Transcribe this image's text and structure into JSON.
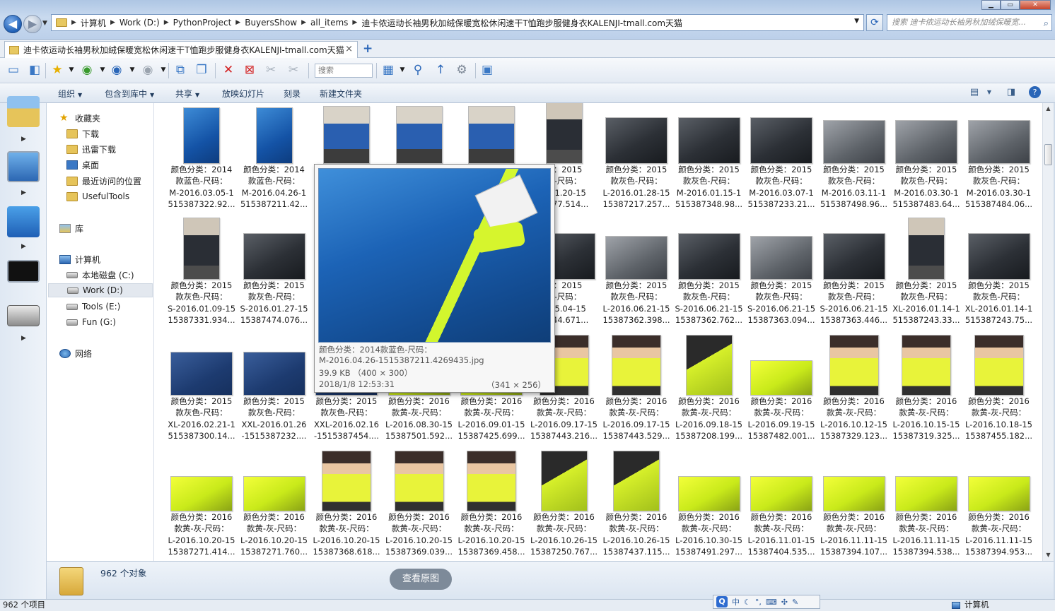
{
  "address": {
    "back_icon": "back-arrow-icon",
    "forward_icon": "forward-arrow-icon",
    "crumbs": [
      "计算机",
      "Work (D:)",
      "PythonProject",
      "BuyersShow",
      "all_items",
      "迪卡侬运动长袖男秋加绒保暖宽松休闲速干T恤跑步服健身衣KALENJI-tmall.com天猫"
    ],
    "search_placeholder": "搜索 迪卡侬运动长袖男秋加绒保暖宽..."
  },
  "tab": {
    "title": "迪卡侬运动长袖男秋加绒保暖宽松休闲速干T恤跑步服健身衣KALENJI-tmall.com天猫",
    "close": "×",
    "new": "+"
  },
  "toolbar": {
    "search_label": "搜索"
  },
  "commands": [
    {
      "label": "组织",
      "dropdown": true
    },
    {
      "label": "包含到库中",
      "dropdown": true
    },
    {
      "label": "共享",
      "dropdown": true
    },
    {
      "label": "放映幻灯片",
      "dropdown": false
    },
    {
      "label": "刻录",
      "dropdown": false
    },
    {
      "label": "新建文件夹",
      "dropdown": false
    }
  ],
  "nav": {
    "favorites": "收藏夹",
    "downloads": "下载",
    "xunlei": "迅雷下载",
    "desktop": "桌面",
    "recent": "最近访问的位置",
    "usefultools": "UsefulTools",
    "libraries": "库",
    "computer": "计算机",
    "drive_c": "本地磁盘 (C:)",
    "drive_d": "Work (D:)",
    "drive_e": "Tools (E:)",
    "drive_g": "Fun (G:)",
    "network": "网络"
  },
  "items": [
    {
      "l1": "颜色分类：2014",
      "l2": "款蓝色-尺码：",
      "l3": "M-2016.03.05-1",
      "l4": "515387322.92...",
      "thumb": "blue"
    },
    {
      "l1": "颜色分类：2014",
      "l2": "款蓝色-尺码：",
      "l3": "M-2016.04.26-1",
      "l4": "515387211.42...",
      "thumb": "blue"
    },
    {
      "l1": "",
      "l2": "",
      "l3": "",
      "l4": "",
      "thumb": "person"
    },
    {
      "l1": "",
      "l2": "",
      "l3": "",
      "l4": "",
      "thumb": "person"
    },
    {
      "l1": "",
      "l2": "",
      "l3": "",
      "l4": "",
      "thumb": "person"
    },
    {
      "l1": "...：2015",
      "l2": "...-尺码：",
      "l3": "...01.20-15",
      "l4": "...477.514...",
      "thumb": "persondk"
    },
    {
      "l1": "颜色分类：2015",
      "l2": "款灰色-尺码：",
      "l3": "L-2016.01.28-15",
      "l4": "15387217.257...",
      "thumb": "dark"
    },
    {
      "l1": "颜色分类：2015",
      "l2": "款灰色-尺码：",
      "l3": "M-2016.01.15-1",
      "l4": "515387348.98...",
      "thumb": "dark"
    },
    {
      "l1": "颜色分类：2015",
      "l2": "款灰色-尺码：",
      "l3": "M-2016.03.07-1",
      "l4": "515387233.21...",
      "thumb": "dark"
    },
    {
      "l1": "颜色分类：2015",
      "l2": "款灰色-尺码：",
      "l3": "M-2016.03.11-1",
      "l4": "515387498.96...",
      "thumb": "grey"
    },
    {
      "l1": "颜色分类：2015",
      "l2": "款灰色-尺码：",
      "l3": "M-2016.03.30-1",
      "l4": "515387483.64...",
      "thumb": "grey"
    },
    {
      "l1": "颜色分类：2015",
      "l2": "款灰色-尺码：",
      "l3": "M-2016.03.30-1",
      "l4": "515387484.06...",
      "thumb": "grey"
    },
    {
      "l1": "颜色分类：2015",
      "l2": "款灰色-尺码：",
      "l3": "S-2016.01.09-15",
      "l4": "15387331.934...",
      "thumb": "persondk"
    },
    {
      "l1": "颜色分类：2015",
      "l2": "款灰色-尺码：",
      "l3": "S-2016.01.27-15",
      "l4": "15387474.076...",
      "thumb": "dark"
    },
    {
      "l1": "",
      "l2": "",
      "l3": "",
      "l4": "",
      "thumb": "dark"
    },
    {
      "l1": "",
      "l2": "",
      "l3": "",
      "l4": "",
      "thumb": "dark"
    },
    {
      "l1": "",
      "l2": "",
      "l3": "",
      "l4": "",
      "thumb": "dark"
    },
    {
      "l1": "...：2015",
      "l2": "...-尺码：",
      "l3": "...05.04-15",
      "l4": "...344.671...",
      "thumb": "dark"
    },
    {
      "l1": "颜色分类：2015",
      "l2": "款灰色-尺码：",
      "l3": "L-2016.06.21-15",
      "l4": "15387362.398...",
      "thumb": "grey"
    },
    {
      "l1": "颜色分类：2015",
      "l2": "款灰色-尺码：",
      "l3": "S-2016.06.21-15",
      "l4": "15387362.762...",
      "thumb": "dark"
    },
    {
      "l1": "颜色分类：2015",
      "l2": "款灰色-尺码：",
      "l3": "S-2016.06.21-15",
      "l4": "15387363.094...",
      "thumb": "grey"
    },
    {
      "l1": "颜色分类：2015",
      "l2": "款灰色-尺码：",
      "l3": "S-2016.06.21-15",
      "l4": "15387363.446...",
      "thumb": "dark"
    },
    {
      "l1": "颜色分类：2015",
      "l2": "款灰色-尺码：",
      "l3": "XL-2016.01.14-1",
      "l4": "515387243.33...",
      "thumb": "persondk"
    },
    {
      "l1": "颜色分类：2015",
      "l2": "款灰色-尺码：",
      "l3": "XL-2016.01.14-1",
      "l4": "515387243.75...",
      "thumb": "dark"
    },
    {
      "l1": "颜色分类：2015",
      "l2": "款灰色-尺码：",
      "l3": "XL-2016.02.21-1",
      "l4": "515387300.14...",
      "thumb": "navy"
    },
    {
      "l1": "颜色分类：2015",
      "l2": "款灰色-尺码：",
      "l3": "XXL-2016.01.26",
      "l4": "-1515387232....",
      "thumb": "navy"
    },
    {
      "l1": "颜色分类：2015",
      "l2": "款灰色-尺码：",
      "l3": "XXL-2016.02.16",
      "l4": "-1515387454....",
      "thumb": "navy"
    },
    {
      "l1": "颜色分类：2016",
      "l2": "款黄-灰-尺码：",
      "l3": "L-2016.08.30-15",
      "l4": "15387501.592...",
      "thumb": "yellow"
    },
    {
      "l1": "颜色分类：2016",
      "l2": "款黄-灰-尺码：",
      "l3": "L-2016.09.01-15",
      "l4": "15387425.699...",
      "thumb": "yellow"
    },
    {
      "l1": "颜色分类：2016",
      "l2": "款黄-灰-尺码：",
      "l3": "L-2016.09.17-15",
      "l4": "15387443.216...",
      "thumb": "ypers"
    },
    {
      "l1": "颜色分类：2016",
      "l2": "款黄-灰-尺码：",
      "l3": "L-2016.09.17-15",
      "l4": "15387443.529...",
      "thumb": "ypers"
    },
    {
      "l1": "颜色分类：2016",
      "l2": "款黄-灰-尺码：",
      "l3": "L-2016.09.18-15",
      "l4": "15387208.199...",
      "thumb": "ydark"
    },
    {
      "l1": "颜色分类：2016",
      "l2": "款黄-灰-尺码：",
      "l3": "L-2016.09.19-15",
      "l4": "15387482.001...",
      "thumb": "yellow"
    },
    {
      "l1": "颜色分类：2016",
      "l2": "款黄-灰-尺码：",
      "l3": "L-2016.10.12-15",
      "l4": "15387329.123...",
      "thumb": "ypers"
    },
    {
      "l1": "颜色分类：2016",
      "l2": "款黄-灰-尺码：",
      "l3": "L-2016.10.15-15",
      "l4": "15387319.325...",
      "thumb": "ypers"
    },
    {
      "l1": "颜色分类：2016",
      "l2": "款黄-灰-尺码：",
      "l3": "L-2016.10.18-15",
      "l4": "15387455.182...",
      "thumb": "ypers"
    },
    {
      "l1": "颜色分类：2016",
      "l2": "款黄-灰-尺码：",
      "l3": "L-2016.10.20-15",
      "l4": "15387271.414...",
      "thumb": "yellow"
    },
    {
      "l1": "颜色分类：2016",
      "l2": "款黄-灰-尺码：",
      "l3": "L-2016.10.20-15",
      "l4": "15387271.760...",
      "thumb": "yellow"
    },
    {
      "l1": "颜色分类：2016",
      "l2": "款黄-灰-尺码：",
      "l3": "L-2016.10.20-15",
      "l4": "15387368.618...",
      "thumb": "ypers"
    },
    {
      "l1": "颜色分类：2016",
      "l2": "款黄-灰-尺码：",
      "l3": "L-2016.10.20-15",
      "l4": "15387369.039...",
      "thumb": "ypers"
    },
    {
      "l1": "颜色分类：2016",
      "l2": "款黄-灰-尺码：",
      "l3": "L-2016.10.20-15",
      "l4": "15387369.458...",
      "thumb": "ypers"
    },
    {
      "l1": "颜色分类：2016",
      "l2": "款黄-灰-尺码：",
      "l3": "L-2016.10.26-15",
      "l4": "15387250.767...",
      "thumb": "ydark"
    },
    {
      "l1": "颜色分类：2016",
      "l2": "款黄-灰-尺码：",
      "l3": "L-2016.10.26-15",
      "l4": "15387437.115...",
      "thumb": "ydark"
    },
    {
      "l1": "颜色分类：2016",
      "l2": "款黄-灰-尺码：",
      "l3": "L-2016.10.30-15",
      "l4": "15387491.297...",
      "thumb": "yellow"
    },
    {
      "l1": "颜色分类：2016",
      "l2": "款黄-灰-尺码：",
      "l3": "L-2016.11.01-15",
      "l4": "15387404.535...",
      "thumb": "yellow"
    },
    {
      "l1": "颜色分类：2016",
      "l2": "款黄-灰-尺码：",
      "l3": "L-2016.11.11-15",
      "l4": "15387394.107...",
      "thumb": "yellow"
    },
    {
      "l1": "颜色分类：2016",
      "l2": "款黄-灰-尺码：",
      "l3": "L-2016.11.11-15",
      "l4": "15387394.538...",
      "thumb": "yellow"
    },
    {
      "l1": "颜色分类：2016",
      "l2": "款黄-灰-尺码：",
      "l3": "L-2016.11.11-15",
      "l4": "15387394.953...",
      "thumb": "yellow"
    }
  ],
  "preview": {
    "line1": "颜色分类：2014款蓝色-尺码：",
    "line2": "M-2016.04.26-1515387211.4269435.jpg",
    "line3": "39.9 KB （400 × 300）",
    "line4": "2018/1/8 12:53:31",
    "dims": "（341 × 256）"
  },
  "details": {
    "count": "962 个对象"
  },
  "view_original": "查看原图",
  "status": {
    "left": "962 个项目",
    "right": "计算机"
  },
  "ime": {
    "logo": "Q",
    "mode": "中"
  }
}
